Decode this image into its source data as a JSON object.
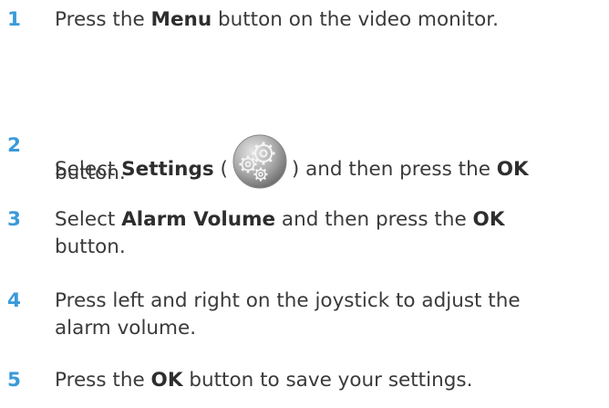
{
  "colors": {
    "accent": "#3a9ad9",
    "text": "#3a3a3a"
  },
  "steps": [
    {
      "number": "1",
      "line1": [
        "Press the ",
        "Menu",
        " button on the video monitor."
      ]
    },
    {
      "number": "2",
      "line1a": [
        "Select ",
        "Settings",
        " ("
      ],
      "icon": "settings-gears-icon",
      "line1b": [
        ") and then press the ",
        "OK"
      ],
      "line2": "button."
    },
    {
      "number": "3",
      "line1": [
        "Select ",
        "Alarm Volume",
        " and then press the ",
        "OK"
      ],
      "line2": "button."
    },
    {
      "number": "4",
      "line1": "Press left and right on the joystick to adjust the",
      "line2": "alarm volume."
    },
    {
      "number": "5",
      "line1": [
        "Press the ",
        "OK",
        " button to save your settings."
      ]
    }
  ]
}
